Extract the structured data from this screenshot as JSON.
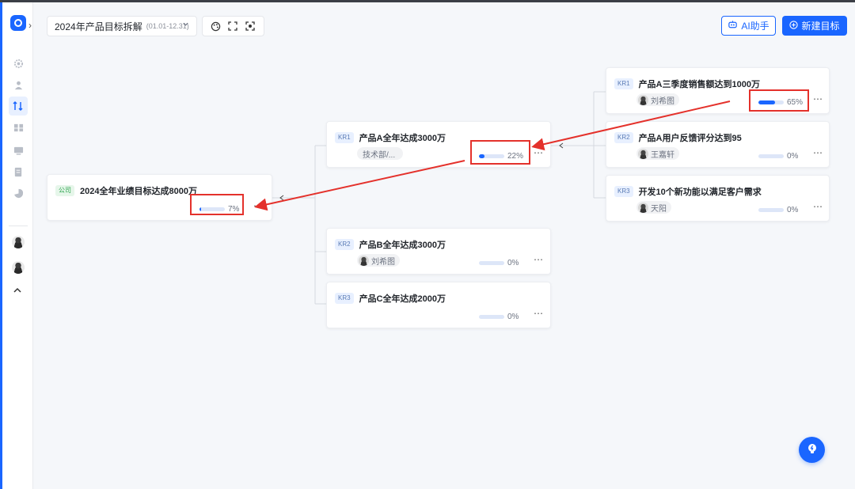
{
  "header": {
    "title": "2024年产品目标拆解",
    "date_range": "(01.01-12.31)",
    "ai_label": "AI助手",
    "new_label": "新建目标"
  },
  "colors": {
    "accent": "#1a66ff",
    "annotation": "#e4312b"
  },
  "company_objective": {
    "tag": "公司",
    "title": "2024全年业绩目标达成8000万",
    "progress": 7,
    "progress_label": "7%"
  },
  "mid_krs": [
    {
      "tag": "KR1",
      "title": "产品A全年达成3000万",
      "owner": "技术部/...",
      "progress": 22,
      "progress_label": "22%"
    },
    {
      "tag": "KR2",
      "title": "产品B全年达成3000万",
      "owner": "刘希图",
      "progress": 0,
      "progress_label": "0%"
    },
    {
      "tag": "KR3",
      "title": "产品C全年达成2000万",
      "owner": "",
      "progress": 0,
      "progress_label": "0%"
    }
  ],
  "right_krs": [
    {
      "tag": "KR1",
      "title": "产品A三季度销售额达到1000万",
      "owner": "刘希图",
      "progress": 65,
      "progress_label": "65%"
    },
    {
      "tag": "KR2",
      "title": "产品A用户反馈评分达到95",
      "owner": "王嘉轩",
      "progress": 0,
      "progress_label": "0%"
    },
    {
      "tag": "KR3",
      "title": "开发10个新功能以满足客户需求",
      "owner": "天阳",
      "progress": 0,
      "progress_label": "0%"
    }
  ]
}
